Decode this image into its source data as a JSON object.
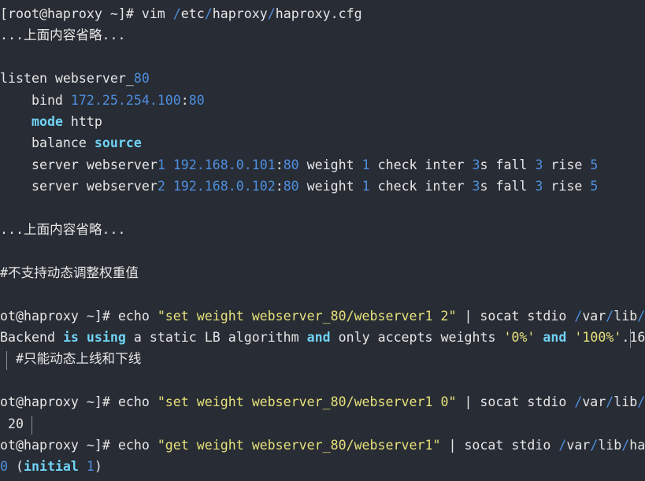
{
  "terminal": {
    "lines": [
      [
        [
          "d",
          "[root@haproxy ~]# vim "
        ],
        [
          "n",
          "/"
        ],
        [
          "d",
          "etc"
        ],
        [
          "n",
          "/"
        ],
        [
          "d",
          "haproxy"
        ],
        [
          "n",
          "/"
        ],
        [
          "d",
          "haproxy.cfg"
        ]
      ],
      [
        [
          "d",
          "...上面内容省略..."
        ]
      ],
      [],
      [
        [
          "d",
          "listen webserver_"
        ],
        [
          "n",
          "80"
        ]
      ],
      [
        [
          "d",
          "    bind "
        ],
        [
          "n",
          "172.25.254.100"
        ],
        [
          "d",
          ":"
        ],
        [
          "n",
          "80"
        ]
      ],
      [
        [
          "d",
          "    "
        ],
        [
          "k",
          "mode"
        ],
        [
          "d",
          " http"
        ]
      ],
      [
        [
          "d",
          "    balance "
        ],
        [
          "k",
          "source"
        ]
      ],
      [
        [
          "d",
          "    server webserver"
        ],
        [
          "n",
          "1"
        ],
        [
          "d",
          " "
        ],
        [
          "n",
          "192.168.0.101"
        ],
        [
          "d",
          ":"
        ],
        [
          "n",
          "80"
        ],
        [
          "d",
          " weight "
        ],
        [
          "n",
          "1"
        ],
        [
          "d",
          " check inter "
        ],
        [
          "n",
          "3"
        ],
        [
          "d",
          "s fall "
        ],
        [
          "n",
          "3"
        ],
        [
          "d",
          " rise "
        ],
        [
          "n",
          "5"
        ]
      ],
      [
        [
          "d",
          "    server webserver"
        ],
        [
          "n",
          "2"
        ],
        [
          "d",
          " "
        ],
        [
          "n",
          "192.168.0.102"
        ],
        [
          "d",
          ":"
        ],
        [
          "n",
          "80"
        ],
        [
          "d",
          " weight "
        ],
        [
          "n",
          "1"
        ],
        [
          "d",
          " check inter "
        ],
        [
          "n",
          "3"
        ],
        [
          "d",
          "s fall "
        ],
        [
          "n",
          "3"
        ],
        [
          "d",
          " rise "
        ],
        [
          "n",
          "5"
        ]
      ],
      [],
      [
        [
          "d",
          "...上面内容省略..."
        ]
      ],
      [],
      [
        [
          "d",
          "#不支持动态调整权重值"
        ]
      ],
      [],
      [
        [
          "d",
          "ot@haproxy ~]# echo "
        ],
        [
          "s",
          "\"set weight webserver_80/webserver1 2\""
        ],
        [
          "d",
          " | socat stdio "
        ],
        [
          "n",
          "/"
        ],
        [
          "d",
          "var"
        ],
        [
          "n",
          "/"
        ],
        [
          "d",
          "lib"
        ],
        [
          "n",
          "/"
        ],
        [
          "d",
          "hap"
        ]
      ],
      [
        [
          "d",
          "Backend "
        ],
        [
          "k",
          "is"
        ],
        [
          "d",
          " "
        ],
        [
          "k",
          "using"
        ],
        [
          "d",
          " a static LB algorithm "
        ],
        [
          "k",
          "and"
        ],
        [
          "d",
          " only accepts weights "
        ],
        [
          "s",
          "'0%'"
        ],
        [
          "d",
          " "
        ],
        [
          "k",
          "and"
        ],
        [
          "d",
          " "
        ],
        [
          "s",
          "'100%'"
        ],
        [
          "d",
          ".16"
        ]
      ],
      [
        [
          "d",
          "  #只能动态上线和下线"
        ]
      ],
      [],
      [
        [
          "d",
          "ot@haproxy ~]# echo "
        ],
        [
          "s",
          "\"set weight webserver_80/webserver1 0\""
        ],
        [
          "d",
          " | socat stdio "
        ],
        [
          "n",
          "/"
        ],
        [
          "d",
          "var"
        ],
        [
          "n",
          "/"
        ],
        [
          "d",
          "lib"
        ],
        [
          "n",
          "/"
        ],
        [
          "d",
          "hap"
        ]
      ],
      [
        [
          "d",
          " 20"
        ]
      ],
      [
        [
          "d",
          "ot@haproxy ~]# echo "
        ],
        [
          "s",
          "\"get weight webserver_80/webserver1\""
        ],
        [
          "d",
          " | socat stdio "
        ],
        [
          "n",
          "/"
        ],
        [
          "d",
          "var"
        ],
        [
          "n",
          "/"
        ],
        [
          "d",
          "lib"
        ],
        [
          "n",
          "/"
        ],
        [
          "d",
          "hapro"
        ]
      ],
      [
        [
          "n",
          "0"
        ],
        [
          "d",
          " ("
        ],
        [
          "k",
          "initial"
        ],
        [
          "d",
          " "
        ],
        [
          "n",
          "1"
        ],
        [
          "d",
          ")"
        ]
      ]
    ]
  }
}
